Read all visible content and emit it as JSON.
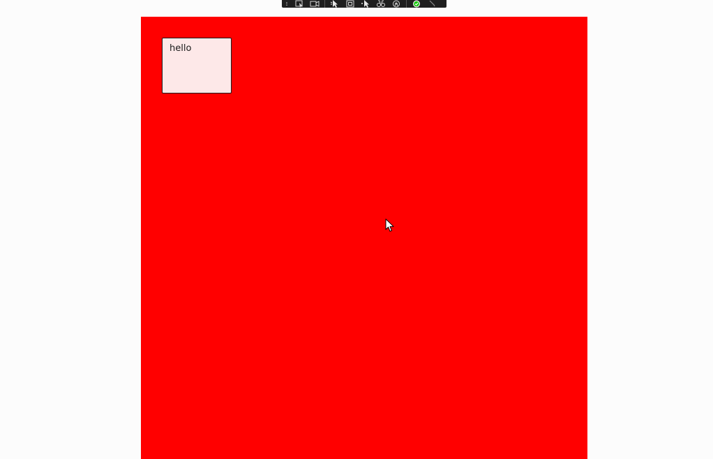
{
  "toolbar": {
    "buttons": [
      {
        "icon": "select-element-icon"
      },
      {
        "icon": "video-camera-icon"
      },
      {
        "icon": "pointer-select-icon"
      },
      {
        "icon": "frame-icon"
      },
      {
        "icon": "pointer-tool-icon"
      },
      {
        "icon": "binoculars-icon"
      },
      {
        "icon": "accessibility-icon"
      },
      {
        "icon": "check-circle-icon"
      },
      {
        "icon": "wrench-icon"
      }
    ]
  },
  "canvas": {
    "background": "#ff0000",
    "box": {
      "text": "hello",
      "background": "#fde8e8",
      "border": "#222222"
    }
  }
}
